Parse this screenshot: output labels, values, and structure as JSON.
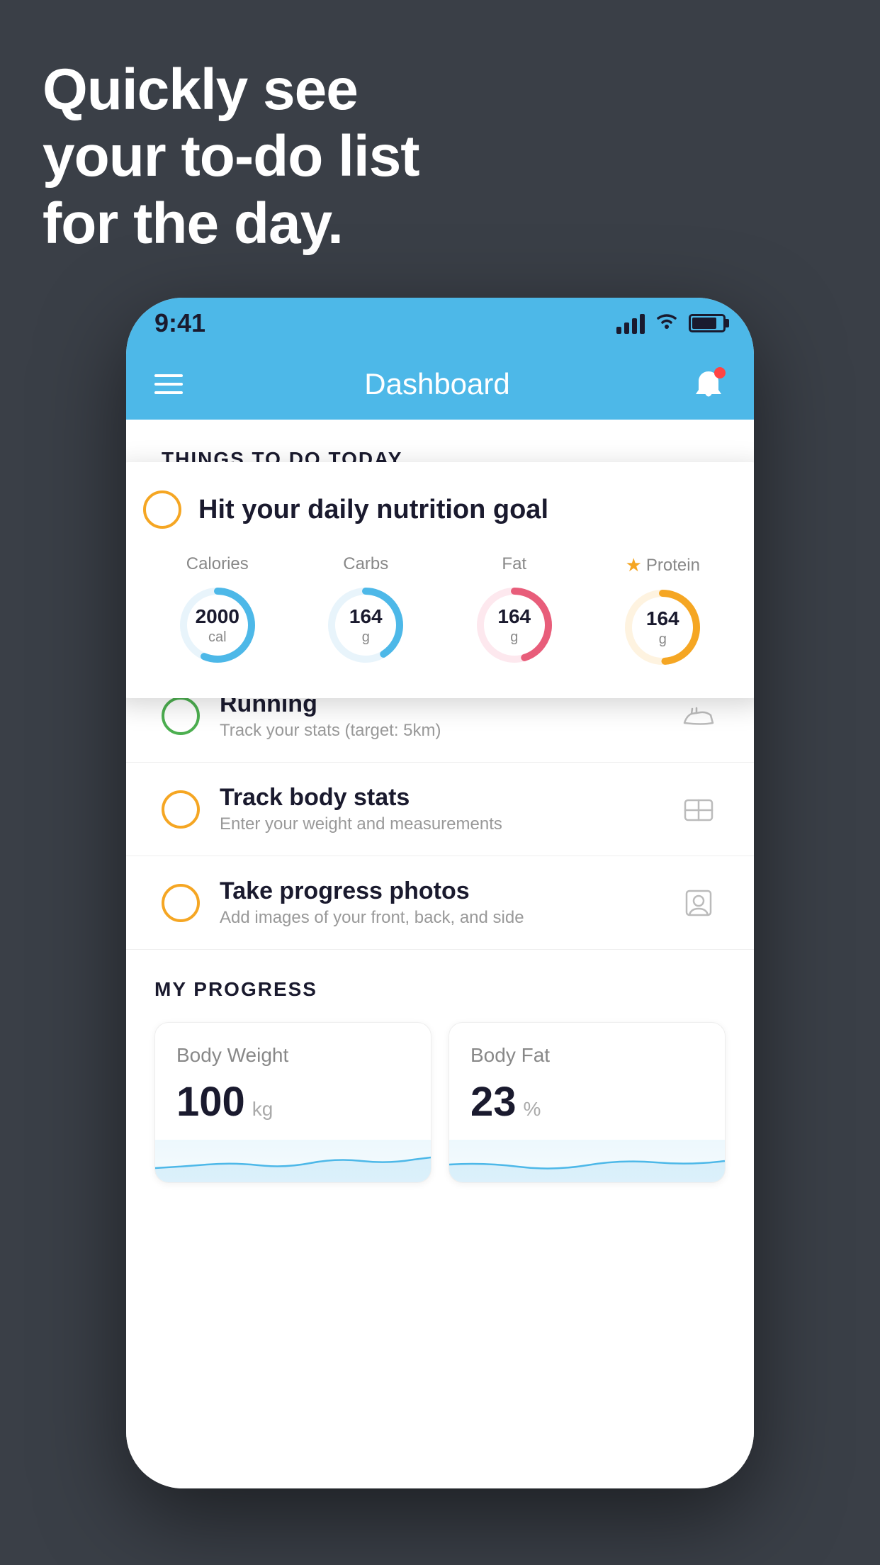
{
  "headline": {
    "line1": "Quickly see",
    "line2": "your to-do list",
    "line3": "for the day."
  },
  "status_bar": {
    "time": "9:41"
  },
  "header": {
    "title": "Dashboard"
  },
  "things_section": {
    "label": "THINGS TO DO TODAY"
  },
  "floating_card": {
    "title": "Hit your daily nutrition goal",
    "nutrients": [
      {
        "label": "Calories",
        "value": "2000",
        "unit": "cal",
        "color": "#4db8e8",
        "track": 75,
        "starred": false
      },
      {
        "label": "Carbs",
        "value": "164",
        "unit": "g",
        "color": "#4db8e8",
        "track": 55,
        "starred": false
      },
      {
        "label": "Fat",
        "value": "164",
        "unit": "g",
        "color": "#e85d7a",
        "track": 60,
        "starred": false
      },
      {
        "label": "Protein",
        "value": "164",
        "unit": "g",
        "color": "#f5a623",
        "track": 65,
        "starred": true
      }
    ]
  },
  "todo_items": [
    {
      "title": "Running",
      "subtitle": "Track your stats (target: 5km)",
      "circle_color": "green",
      "icon": "shoe"
    },
    {
      "title": "Track body stats",
      "subtitle": "Enter your weight and measurements",
      "circle_color": "yellow",
      "icon": "scale"
    },
    {
      "title": "Take progress photos",
      "subtitle": "Add images of your front, back, and side",
      "circle_color": "yellow",
      "icon": "person"
    }
  ],
  "progress_section": {
    "label": "MY PROGRESS",
    "cards": [
      {
        "title": "Body Weight",
        "value": "100",
        "unit": "kg"
      },
      {
        "title": "Body Fat",
        "value": "23",
        "unit": "%"
      }
    ]
  }
}
